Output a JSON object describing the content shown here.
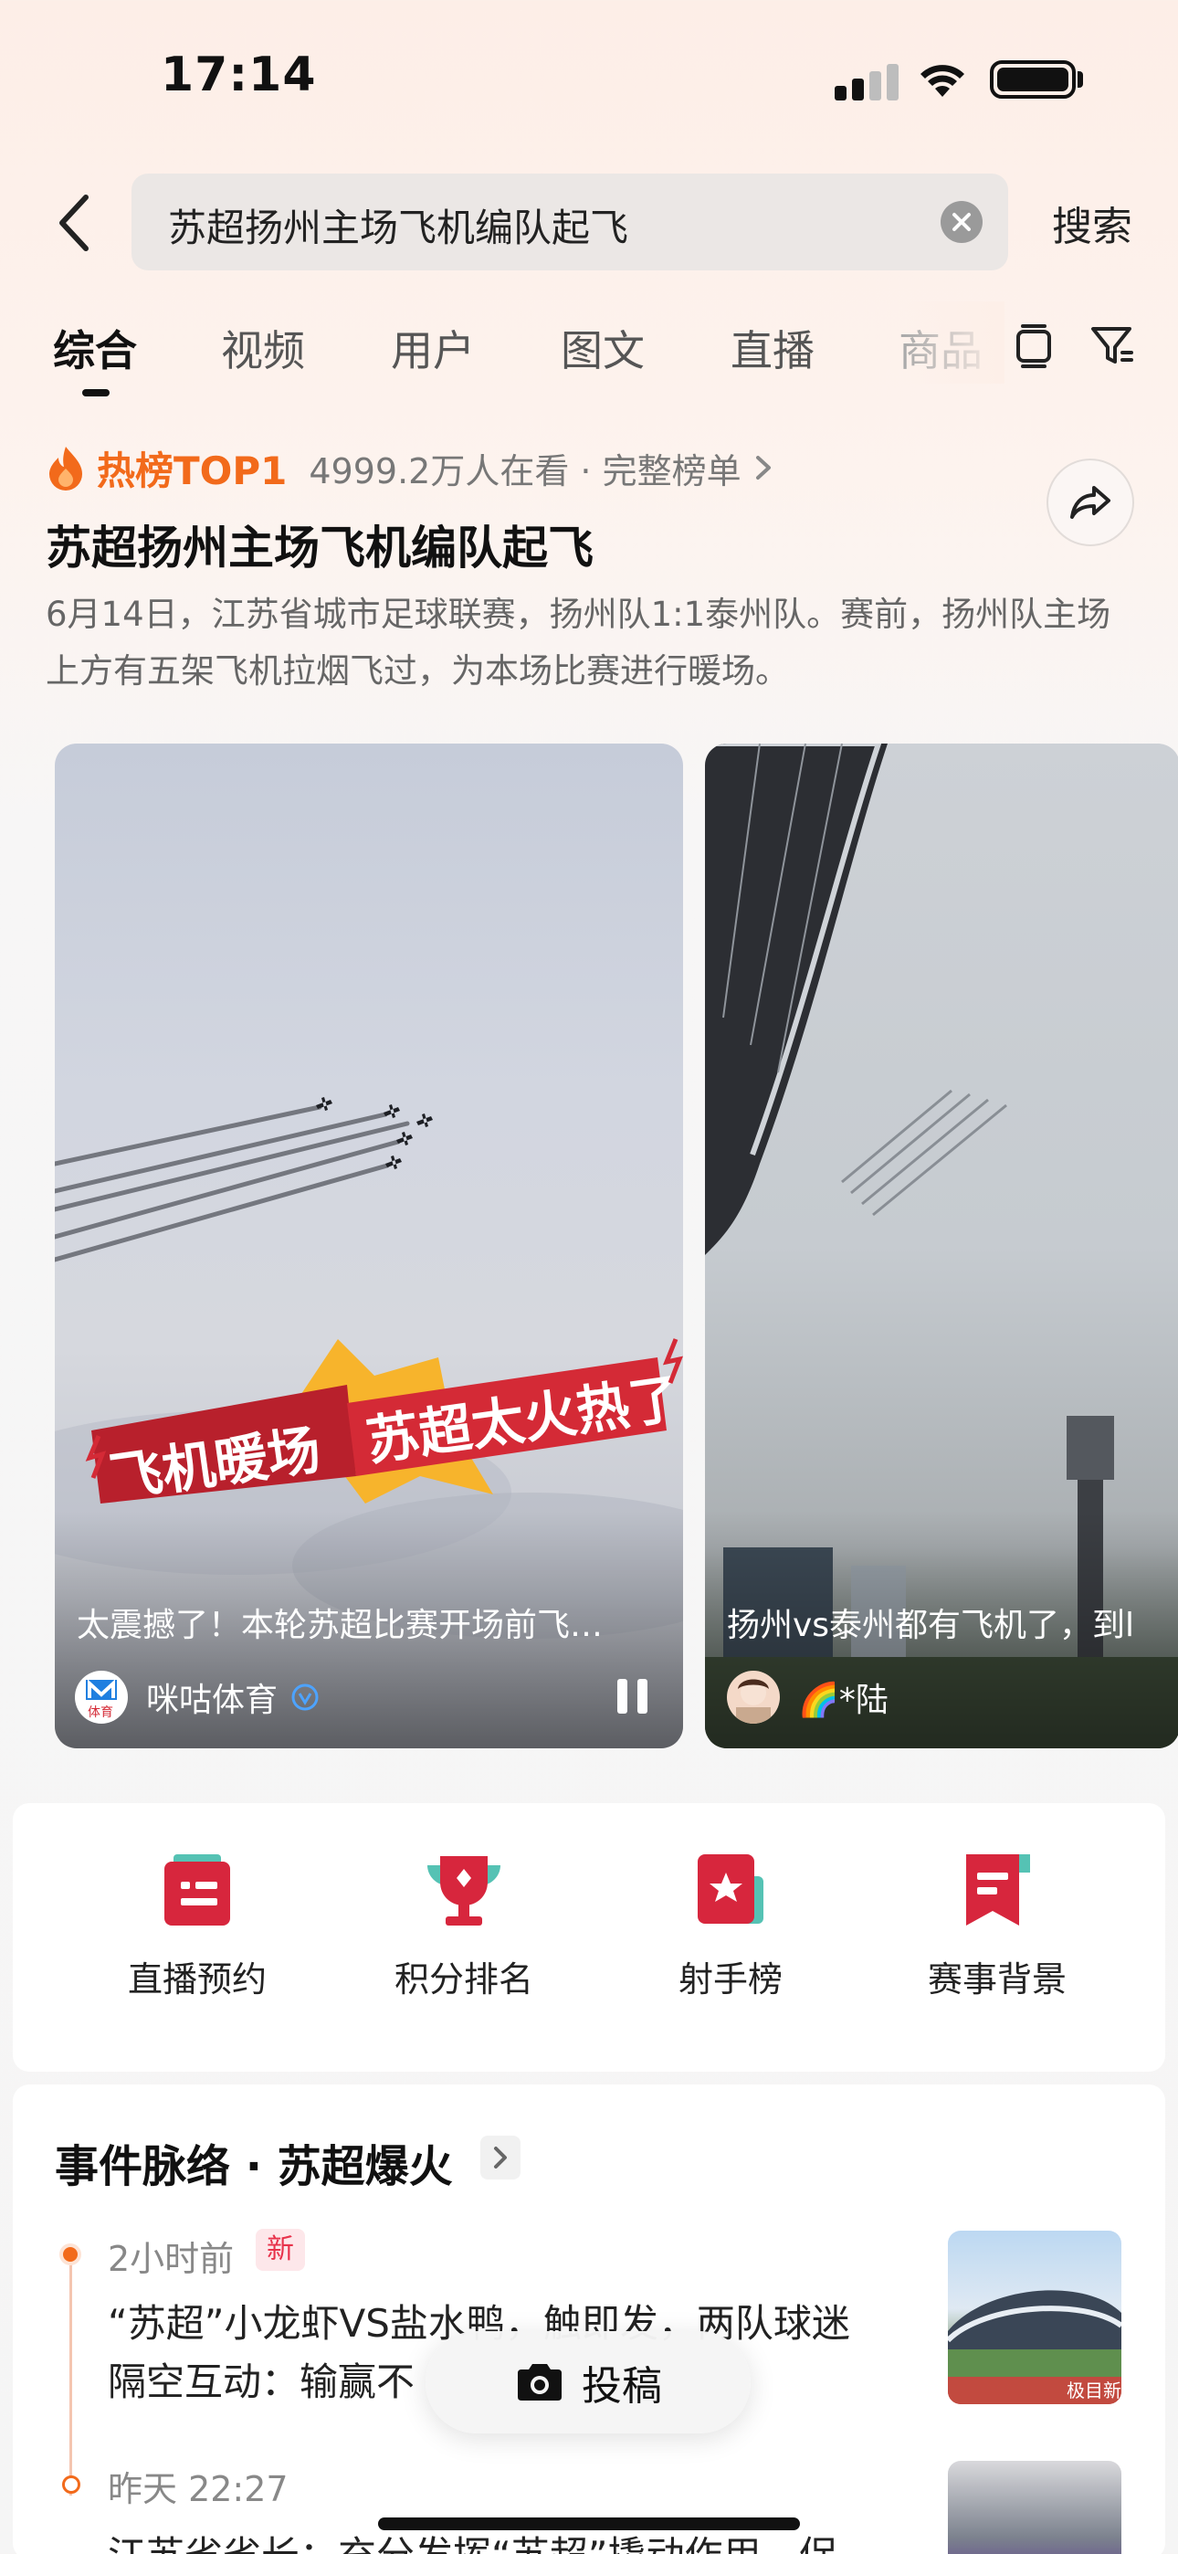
{
  "status_bar": {
    "time": "17:14"
  },
  "search": {
    "query": "苏超扬州主场飞机编队起飞",
    "submit_label": "搜索"
  },
  "tabs": [
    {
      "label": "综合",
      "active": true
    },
    {
      "label": "视频"
    },
    {
      "label": "用户"
    },
    {
      "label": "图文"
    },
    {
      "label": "直播"
    },
    {
      "label": "商品"
    }
  ],
  "hot_topic": {
    "rank_label": "热榜TOP1",
    "meta": "4999.2万人在看 · 完整榜单",
    "title": "苏超扬州主场飞机编队起飞",
    "description": "6月14日，江苏省城市足球联赛，扬州队1:1泰州队。赛前，扬州队主场上方有五架飞机拉烟飞过，为本场比赛进行暖场。"
  },
  "videos": [
    {
      "banner_text_1": "飞机暖场",
      "banner_text_2": "苏超太火热了",
      "caption": "太震撼了！本轮苏超比赛开场前飞…",
      "author": "咪咕体育",
      "author_logo_text": "体育"
    },
    {
      "caption": "扬州vs泰州都有飞机了，到l",
      "author": "🌈*陆"
    }
  ],
  "quick_entries": [
    {
      "label": "直播预约",
      "icon": "calendar-list-icon"
    },
    {
      "label": "积分排名",
      "icon": "trophy-icon"
    },
    {
      "label": "射手榜",
      "icon": "star-book-icon"
    },
    {
      "label": "赛事背景",
      "icon": "flag-icon"
    }
  ],
  "events": {
    "header": "事件脉络 · 苏超爆火",
    "items": [
      {
        "time": "2小时前",
        "badge": "新",
        "text_line_1": "“苏超”小龙虾VS盐水鸭，触即发，两队球迷",
        "text_line_2": "隔空互动：输赢不",
        "thumb_watermark": "极目新"
      },
      {
        "time": "昨天 22:27",
        "text_line_1": "江苏省省长：充分发挥“苏超”撬动作用，促"
      }
    ]
  },
  "post_button": {
    "label": "投稿"
  },
  "colors": {
    "accent": "#f26a1b",
    "brand_red": "#d7263d",
    "teal": "#55c2b4"
  }
}
